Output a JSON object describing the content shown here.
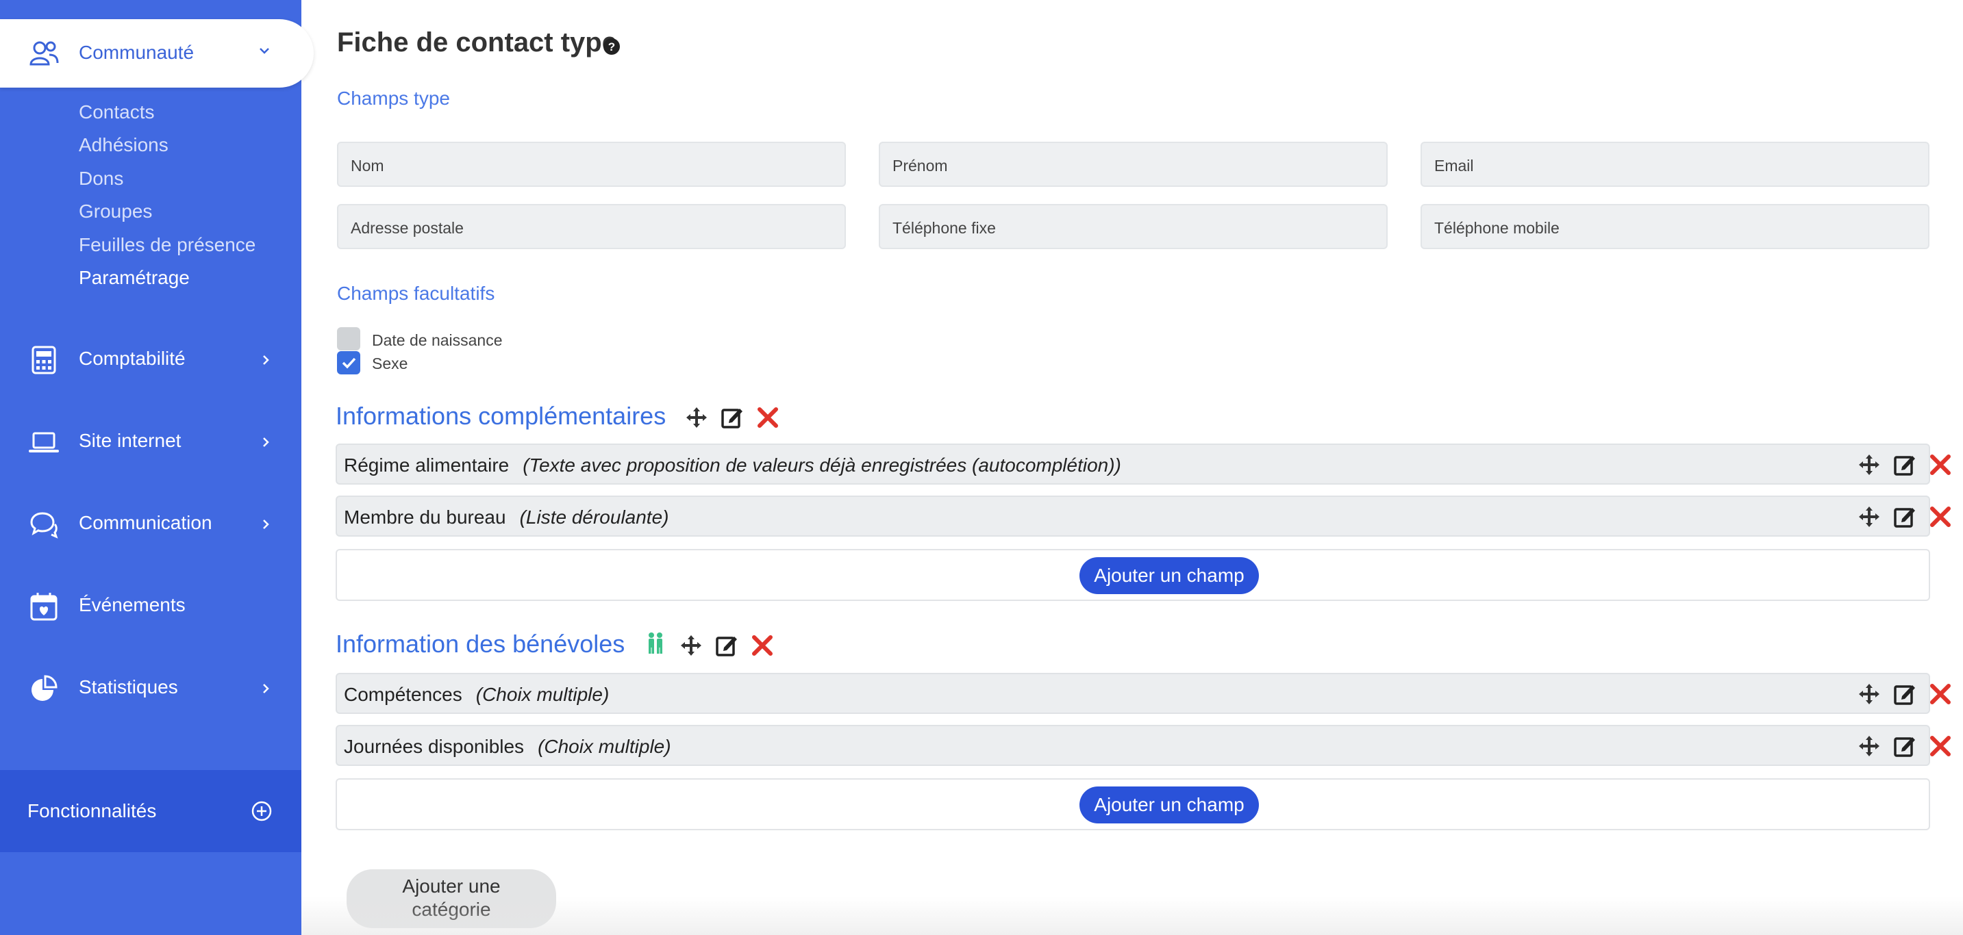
{
  "sidebar": {
    "active": {
      "label": "Communauté",
      "icon": "community-icon"
    },
    "subitems": [
      "Contacts",
      "Adhésions",
      "Dons",
      "Groupes",
      "Feuilles de présence",
      "Paramétrage"
    ],
    "items": [
      {
        "label": "Comptabilité",
        "icon": "calculator-icon"
      },
      {
        "label": "Site internet",
        "icon": "laptop-icon"
      },
      {
        "label": "Communication",
        "icon": "chat-icon"
      },
      {
        "label": "Événements",
        "icon": "calendar-icon"
      },
      {
        "label": "Statistiques",
        "icon": "pie-chart-icon"
      }
    ],
    "features_label": "Fonctionnalités"
  },
  "page": {
    "title": "Fiche de contact type",
    "standard_section": "Champs type",
    "standard_fields": [
      "Nom",
      "Prénom",
      "Email",
      "Adresse postale",
      "Téléphone fixe",
      "Téléphone mobile"
    ],
    "optional_section": "Champs facultatifs",
    "optional_fields": [
      {
        "label": "Date de naissance",
        "checked": false
      },
      {
        "label": "Sexe",
        "checked": true
      }
    ],
    "groups": [
      {
        "title": "Informations complémentaires",
        "fields": [
          {
            "name": "Régime alimentaire",
            "type": "(Texte avec proposition de valeurs déjà enregistrées (autocomplétion))"
          },
          {
            "name": "Membre du bureau",
            "type": "(Liste déroulante)"
          }
        ],
        "add_label": "Ajouter un champ"
      },
      {
        "title": "Information des bénévoles",
        "fields": [
          {
            "name": "Compétences",
            "type": "(Choix multiple)"
          },
          {
            "name": "Journées disponibles",
            "type": "(Choix multiple)"
          }
        ],
        "add_label": "Ajouter un champ"
      }
    ],
    "add_category_line1": "Ajouter une",
    "add_category_line2": "catégorie"
  },
  "colors": {
    "sidebar": "#4169e1",
    "accent": "#3a6fe0",
    "delete": "#e0342b",
    "volunteer": "#3cc18a"
  }
}
